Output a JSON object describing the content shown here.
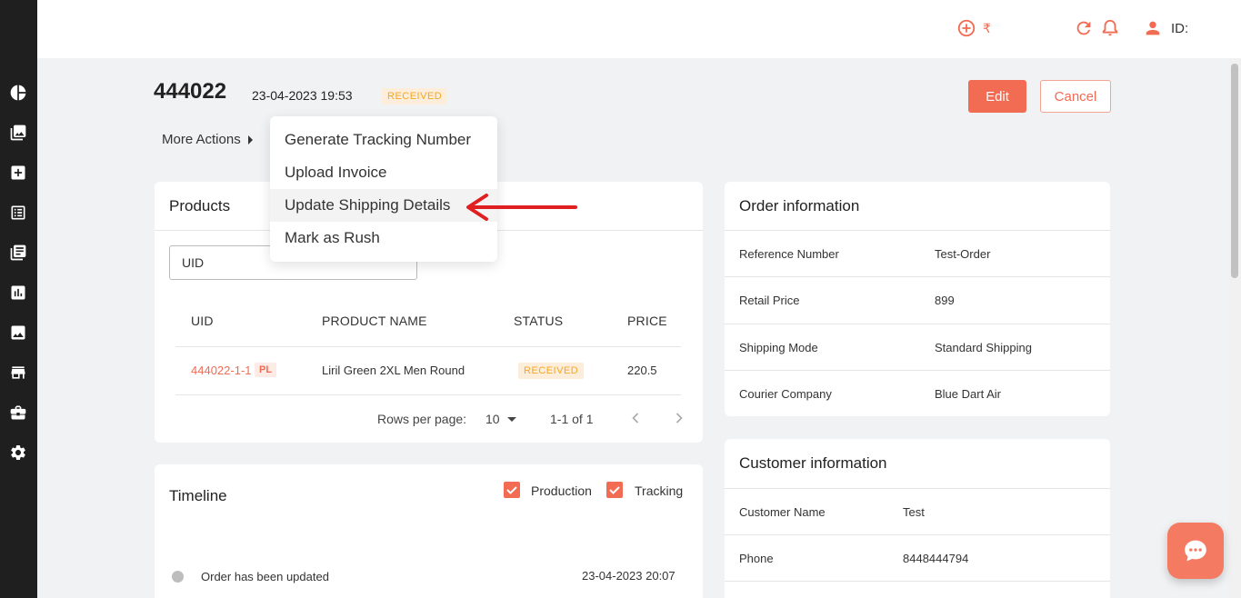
{
  "header": {
    "currency_symbol": "₹",
    "id_label": "ID:"
  },
  "sidebar": {
    "items": [
      "dashboard-icon",
      "gallery-icon",
      "add-icon",
      "orders-list-icon",
      "catalog-icon",
      "analytics-icon",
      "media-icon",
      "store-icon",
      "briefcase-icon",
      "settings-icon"
    ]
  },
  "order": {
    "id": "444022",
    "datetime": "23-04-2023 19:53",
    "status": "RECEIVED",
    "edit_label": "Edit",
    "cancel_label": "Cancel",
    "more_actions_label": "More Actions"
  },
  "menu": {
    "items": [
      "Generate Tracking Number",
      "Upload Invoice",
      "Update Shipping Details",
      "Mark as Rush"
    ],
    "highlighted_index": 2
  },
  "products": {
    "title": "Products",
    "search_value": "UID",
    "columns": [
      "UID",
      "PRODUCT NAME",
      "STATUS",
      "PRICE"
    ],
    "rows": [
      {
        "uid": "444022-1-1",
        "tag": "PL",
        "name": "Liril Green 2XL Men Round",
        "status": "RECEIVED",
        "price": "220.5"
      }
    ],
    "rows_per_page_label": "Rows per page:",
    "rows_per_page": "10",
    "range": "1-1 of 1"
  },
  "timeline": {
    "title": "Timeline",
    "filters": [
      {
        "label": "Production",
        "checked": true
      },
      {
        "label": "Tracking",
        "checked": true
      }
    ],
    "events": [
      {
        "text": "Order has been updated",
        "date": "23-04-2023 20:07"
      }
    ]
  },
  "order_information": {
    "title": "Order information",
    "rows": [
      {
        "label": "Reference Number",
        "value": "Test-Order"
      },
      {
        "label": "Retail Price",
        "value": "899"
      },
      {
        "label": "Shipping Mode",
        "value": "Standard Shipping"
      },
      {
        "label": "Courier Company",
        "value": "Blue Dart Air"
      }
    ]
  },
  "customer_information": {
    "title": "Customer information",
    "rows": [
      {
        "label": "Customer Name",
        "value": "Test"
      },
      {
        "label": "Phone",
        "value": "8448444794"
      }
    ]
  },
  "colors": {
    "accent": "#f26b53",
    "badge_bg": "#fdeedc",
    "badge_text": "#f5a623",
    "sidebar_bg": "#1f1f1f",
    "annotation_arrow": "#e02020"
  }
}
